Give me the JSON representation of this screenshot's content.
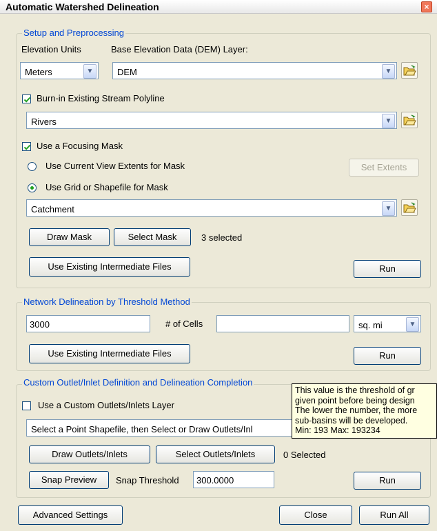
{
  "window": {
    "title": "Automatic Watershed Delineation",
    "close_glyph": "×"
  },
  "setup": {
    "legend": "Setup and Preprocessing",
    "elevation_units_label": "Elevation Units",
    "dem_layer_label": "Base Elevation Data (DEM) Layer:",
    "elevation_units_value": "Meters",
    "dem_value": "DEM",
    "burn_in_label": "Burn-in Existing Stream Polyline",
    "burn_in_checked": true,
    "stream_value": "Rivers",
    "focusing_mask_label": "Use a Focusing Mask",
    "focusing_mask_checked": true,
    "radio_view_extents_label": "Use Current View Extents for Mask",
    "radio_grid_label": "Use Grid or Shapefile for Mask",
    "set_extents_label": "Set Extents",
    "mask_value": "Catchment",
    "draw_mask_label": "Draw Mask",
    "select_mask_label": "Select Mask",
    "selected_count_text": "3 selected",
    "use_existing_label": "Use Existing Intermediate Files",
    "run_label": "Run"
  },
  "network": {
    "legend": "Network Delineation by Threshold Method",
    "threshold_value": "3000",
    "cells_label": "# of Cells",
    "area_value": "",
    "unit_value": "sq. mi",
    "use_existing_label": "Use Existing Intermediate Files",
    "run_label": "Run"
  },
  "custom": {
    "legend": "Custom Outlet/Inlet Definition and Delineation Completion",
    "custom_layer_label": "Use a Custom Outlets/Inlets Layer",
    "custom_layer_checked": false,
    "point_shapefile_value": "Select a Point Shapefile, then Select or Draw Outlets/Inl",
    "draw_outlets_label": "Draw Outlets/Inlets",
    "select_outlets_label": "Select Outlets/Inlets",
    "selected_count_text": "0 Selected",
    "snap_preview_label": "Snap Preview",
    "snap_threshold_label": "Snap Threshold",
    "snap_threshold_value": "300.0000",
    "run_label": "Run"
  },
  "footer": {
    "advanced_settings_label": "Advanced Settings",
    "close_label": "Close",
    "run_all_label": "Run All"
  },
  "tooltip": {
    "lines": [
      "This value is the threshold of gr",
      "given point before being design",
      "The lower the number, the more",
      "sub-basins will be developed.",
      "Min: 193  Max: 193234"
    ]
  },
  "colors": {
    "dialog_bg": "#ece9d8",
    "legend_text": "#0046d5",
    "tooltip_bg": "#ffffe1",
    "check_mark": "#21a121"
  }
}
